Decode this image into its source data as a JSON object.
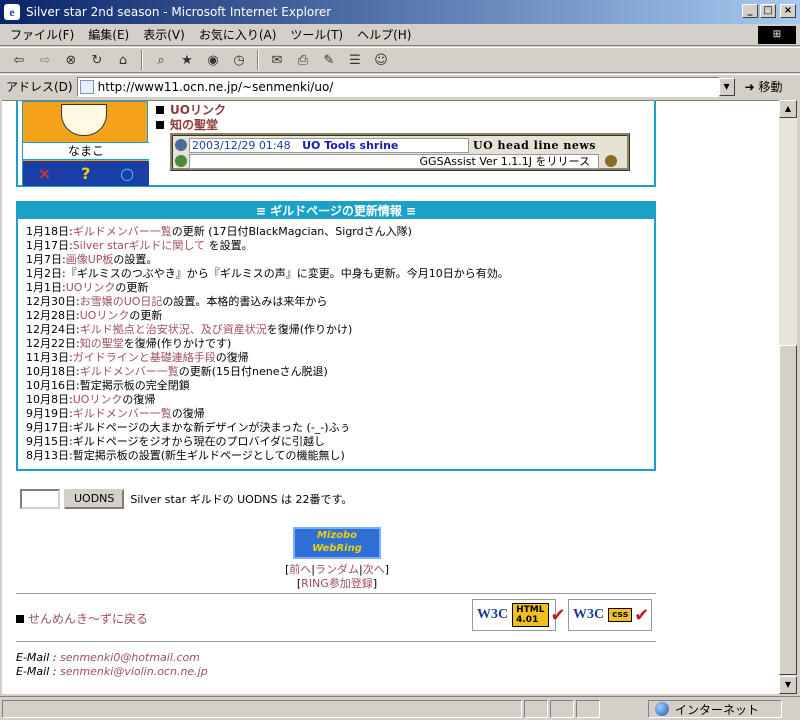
{
  "window": {
    "title": "Silver star 2nd season - Microsoft Internet Explorer",
    "min": "_",
    "max": "□",
    "close": "×"
  },
  "menu": [
    "ファイル(F)",
    "編集(E)",
    "表示(V)",
    "お気に入り(A)",
    "ツール(T)",
    "ヘルプ(H)"
  ],
  "address": {
    "label": "アドレス(D)",
    "url": "http://www11.ocn.ne.jp/~senmenki/uo/",
    "go": "移動"
  },
  "status": {
    "zone": "インターネット"
  },
  "profile": {
    "name": "なまこ",
    "icons": [
      "×",
      "?",
      "○"
    ]
  },
  "top_links": [
    "UOリンク",
    "知の聖堂"
  ],
  "ticker": {
    "date": "2003/12/29 01:48",
    "shrine": "UO Tools shrine",
    "head": "UO head line news",
    "item": "GGSAssist Ver 1.1.1J をリリース"
  },
  "guild": {
    "title": "≡ ギルドページの更新情報 ≡",
    "items": [
      {
        "date": "1月18日:",
        "link": "ギルドメンバー一覧",
        "text": "の更新 (17日付BlackMagcian、Sigrdさん入隊)"
      },
      {
        "date": "1月17日:",
        "link": "Silver starギルドに関して",
        "text": " を設置。"
      },
      {
        "date": "1月7日:",
        "link": "画像UP板",
        "text": "の設置。"
      },
      {
        "date": "1月2日:",
        "link": "",
        "text": "『ギルミスのつぶやき』から『ギルミスの声』に変更。中身も更新。今月10日から有効。"
      },
      {
        "date": "1月1日:",
        "link": "UOリンク",
        "text": "の更新"
      },
      {
        "date": "12月30日:",
        "link": "お雪嬢のUO日記",
        "text": "の設置。本格的書込みは来年から"
      },
      {
        "date": "12月28日:",
        "link": "UOリンク",
        "text": "の更新"
      },
      {
        "date": "12月24日:",
        "link": "ギルド拠点と治安状況、及び資産状況",
        "text": "を復帰(作りかけ)"
      },
      {
        "date": "12月22日:",
        "link": "知の聖堂",
        "text": "を復帰(作りかけです)"
      },
      {
        "date": "11月3日:",
        "link": "ガイドラインと基礎連絡手段",
        "text": "の復帰"
      },
      {
        "date": "10月18日:",
        "link": "ギルドメンバー一覧",
        "text": "の更新(15日付neneさん脱退)"
      },
      {
        "date": "10月16日:",
        "link": "",
        "text": "暫定掲示板の完全閉鎖"
      },
      {
        "date": "10月8日:",
        "link": "UOリンク",
        "text": "の復帰"
      },
      {
        "date": "9月19日:",
        "link": "ギルドメンバー一覧",
        "text": "の復帰"
      },
      {
        "date": "9月17日:",
        "link": "",
        "text": "ギルドページの大まかな新デザインが決まった (-_-)ふぅ"
      },
      {
        "date": "9月15日:",
        "link": "",
        "text": "ギルドページをジオから現在のプロバイダに引越し"
      },
      {
        "date": "8月13日:",
        "link": "",
        "text": "暫定掲示板の設置(新生ギルドページとしての機能無し)"
      }
    ]
  },
  "uodns": {
    "button": "UODNS",
    "text": "Silver star ギルドの UODNS は 22番です。"
  },
  "webring": {
    "logo_top": "Mizobo",
    "logo_bottom": "WebRing",
    "prev": "前へ",
    "random": "ランダム",
    "next": "次へ",
    "join": "RING参加登録"
  },
  "back": "せんめんき〜ずに戻る",
  "badges": {
    "w3c": "W3C",
    "html": "HTML 4.01",
    "css": "css"
  },
  "mails": [
    {
      "label": "E-Mail : ",
      "addr": "senmenki0@hotmail.com"
    },
    {
      "label": "E-Mail : ",
      "addr": "senmenki@violin.ocn.ne.jp"
    }
  ]
}
